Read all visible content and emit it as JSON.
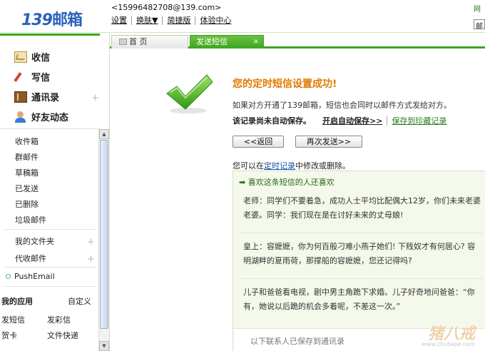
{
  "header": {
    "logo_num": "139",
    "logo_text": "邮箱",
    "email": "<15996482708@139.com>",
    "menu": [
      "设置",
      "换肤▼",
      "简捷版",
      "体验中心"
    ],
    "right_label": "网",
    "right_field": "邮"
  },
  "tabs": [
    {
      "label": "首 页"
    },
    {
      "label": "发送短信",
      "close": "×"
    }
  ],
  "nav": {
    "main": [
      {
        "label": "收信"
      },
      {
        "label": "写信"
      },
      {
        "label": "通讯录",
        "plus": "+"
      },
      {
        "label": "好友动态"
      }
    ],
    "folders": [
      "收件箱",
      "群邮件",
      "草稿箱",
      "已发送",
      "已删除",
      "垃圾邮件"
    ],
    "my_folders": {
      "label": "我的文件夹",
      "plus": "+"
    },
    "agent_mail": {
      "label": "代收邮件",
      "plus": "+"
    },
    "push": "PushEmail",
    "apps_title": "我的应用",
    "apps_custom": "自定义",
    "apps": [
      "发短信",
      "发彩信",
      "贺卡",
      "文件快递"
    ]
  },
  "scrollbar": {
    "up": "▲",
    "down": "▼"
  },
  "content": {
    "title": "您的定时短信设置成功!",
    "line1": "如果对方开通了139邮箱，短信也会同时以邮件方式发给对方。",
    "line2": "该记录尚未自动保存。",
    "auto_save_link": "开启自动保存>>",
    "save_link": "保存到珍藏记录",
    "back_button": "<<返回",
    "again_button": "再次发送>>",
    "modify_pre": "您可以在",
    "modify_link": "定时记录",
    "modify_post": "中修改或删除。",
    "likes_title": "➡ 喜欢这条短信的人还喜欢",
    "messages": [
      [
        "老师：同学们不要着急，成功人士平均比配偶大12岁，你们未来老婆",
        "老婆。同学：我们现在是在讨好未来的丈母娘!"
      ],
      [
        "皇上：容嬷嬷，你为何百般刁难小燕子她们! 下贱奴才有何居心? 容",
        "明湖畔的夏雨荷，那撑船的容嬷嬷，您还记得吗?"
      ],
      [
        "儿子和爸爸看电视，剧中男主角跪下求婚。儿子好奇地问爸爸：“你",
        "有，她说以后跪的机会多着呢，不差这一次。”"
      ]
    ],
    "bottom_text": "以下联系人已保存到通讯录"
  },
  "watermark": {
    "text": "猪八戒",
    "url": "www.zhubajie.com"
  }
}
